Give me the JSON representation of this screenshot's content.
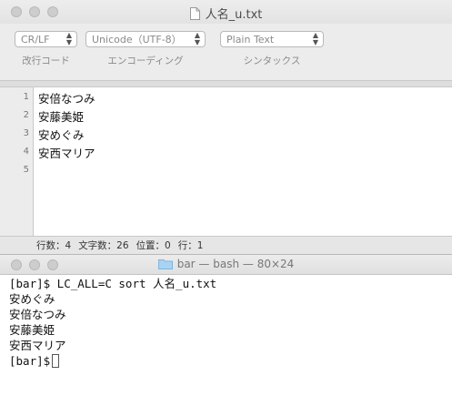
{
  "editor": {
    "title": "人名_u.txt",
    "selects": [
      {
        "value": "CR/LF",
        "label": "改行コード"
      },
      {
        "value": "Unicode（UTF-8）",
        "label": "エンコーディング"
      },
      {
        "value": "Plain Text",
        "label": "シンタックス"
      }
    ],
    "line_numbers": [
      "1",
      "2",
      "3",
      "4",
      "5"
    ],
    "lines": [
      "安倍なつみ",
      "安藤美姫",
      "安めぐみ",
      "安西マリア",
      ""
    ],
    "status": {
      "lines": "行数：4",
      "chars": "文字数：26",
      "position": "位置：0",
      "row": "行：1"
    }
  },
  "terminal": {
    "title": "bar — bash — 80×24",
    "output": [
      "[bar]$ LC_ALL=C sort 人名_u.txt",
      "安めぐみ",
      "安倍なつみ",
      "安藤美姫",
      "安西マリア"
    ],
    "prompt": "[bar]$"
  }
}
